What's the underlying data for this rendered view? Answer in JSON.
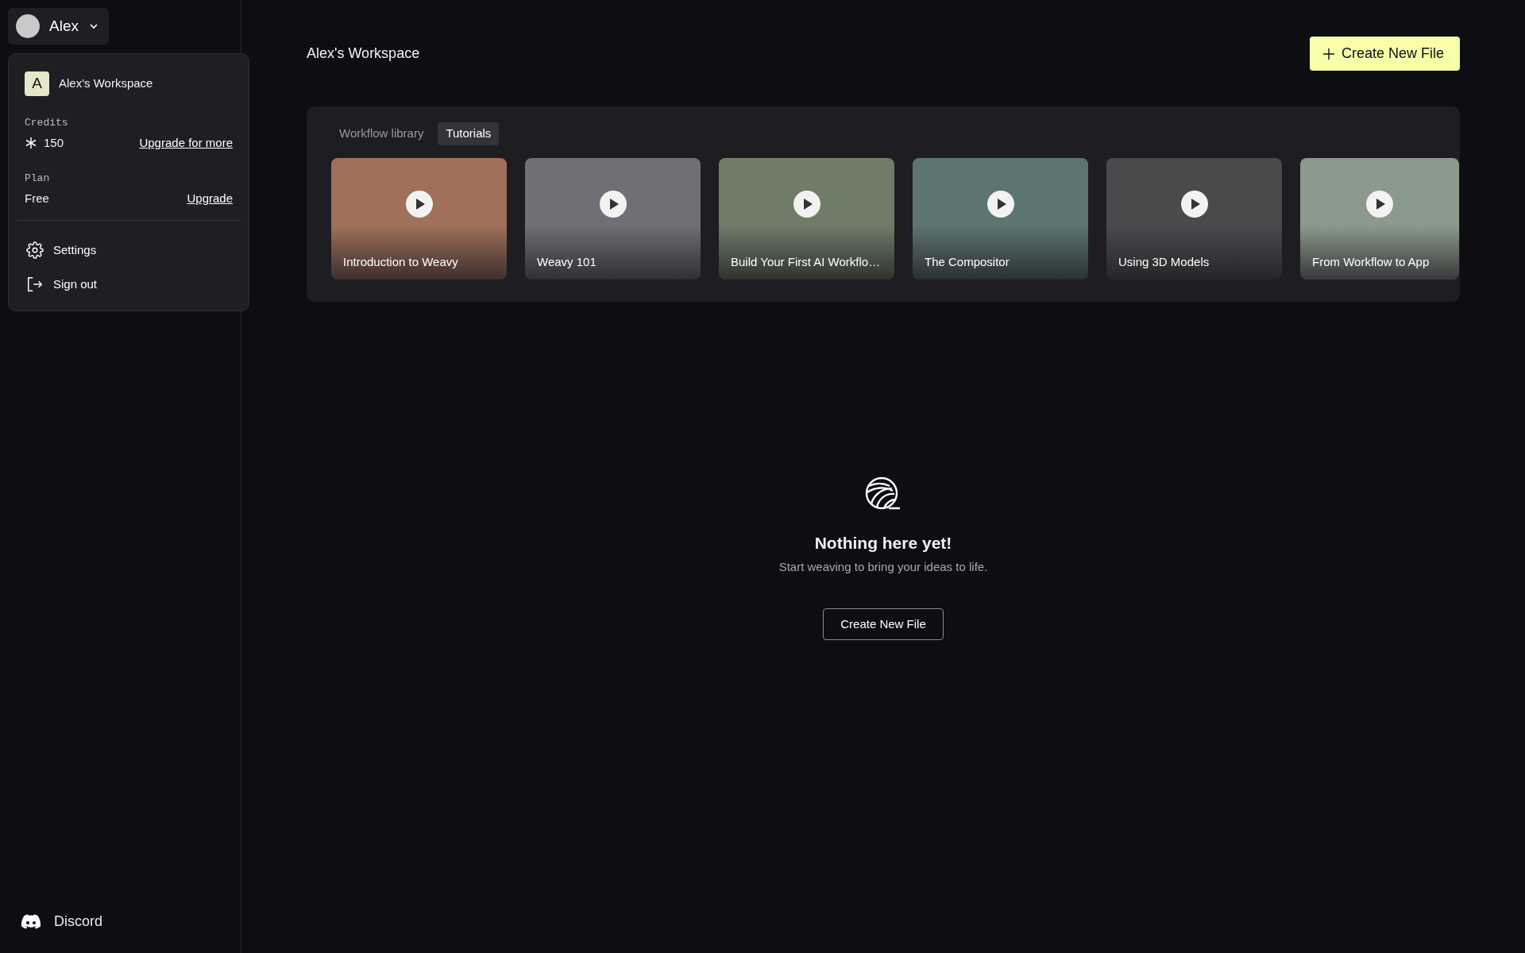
{
  "user_menu": {
    "name": "Alex",
    "expanded": true
  },
  "dropdown": {
    "workspace_initial": "A",
    "workspace_name": "Alex's Workspace",
    "credits_label": "Credits",
    "credits_value": "150",
    "credits_link": "Upgrade for more",
    "plan_label": "Plan",
    "plan_value": "Free",
    "plan_link": "Upgrade",
    "items": [
      {
        "kind": "settings",
        "label": "Settings"
      },
      {
        "kind": "signout",
        "label": "Sign out"
      }
    ]
  },
  "sidebar_footer": {
    "label": "Discord"
  },
  "header": {
    "title": "Alex's Workspace",
    "button": "Create New File"
  },
  "tabs": [
    {
      "label": "Workflow library",
      "selected": false
    },
    {
      "label": "Tutorials",
      "selected": true
    }
  ],
  "tutorials": [
    {
      "title": "Introduction to Weavy",
      "color": "#a0705a"
    },
    {
      "title": "Weavy 101",
      "color": "#6e7075"
    },
    {
      "title": "Build Your First AI Workflo…",
      "color": "#6f7d68"
    },
    {
      "title": "The Compositor",
      "color": "#5d7470"
    },
    {
      "title": "Using 3D Models",
      "color": "#4a4a4d"
    },
    {
      "title": "From Workflow to App",
      "color": "#8c9a8c"
    }
  ],
  "empty_state": {
    "title": "Nothing here yet!",
    "text": "Start weaving to bring your ideas to life.",
    "button": "Create New File"
  }
}
